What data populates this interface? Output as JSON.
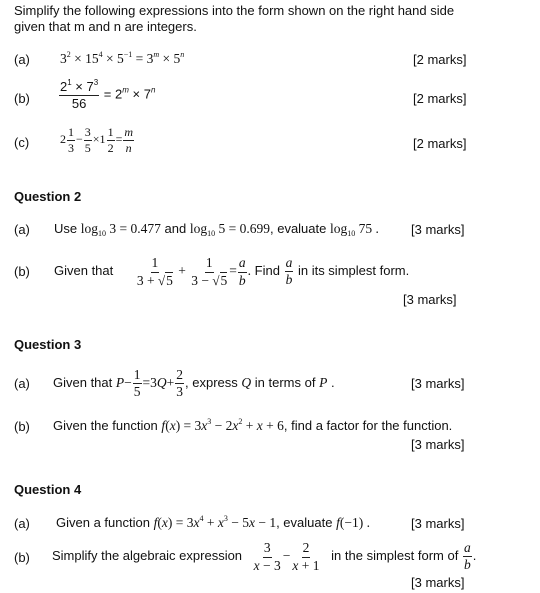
{
  "intro": {
    "line1": "Simplify the following expressions into the form shown on the right hand side",
    "line2": "given that m and n are integers."
  },
  "q1": {
    "a": {
      "label": "(a)",
      "marks": "[2 marks]"
    },
    "b": {
      "label": "(b)",
      "marks": "[2 marks]"
    },
    "c": {
      "label": "(c)",
      "marks": "[2 marks]"
    }
  },
  "q2": {
    "heading": "Question 2",
    "a": {
      "label": "(a)",
      "prefix": "Use",
      "and": "and",
      "mid": ", evaluate",
      "value1": "0.477",
      "value2": "0.699",
      "marks": "[3 marks]"
    },
    "b": {
      "label": "(b)",
      "prefix": "Given that",
      "find": "Find",
      "suffix": "in its simplest form.",
      "marks": "[3 marks]"
    }
  },
  "q3": {
    "heading": "Question 3",
    "a": {
      "label": "(a)",
      "prefix": "Given that",
      "mid": ", express",
      "suffix": "in terms of",
      "marks": "[3 marks]"
    },
    "b": {
      "label": "(b)",
      "prefix": "Given the function",
      "suffix": ", find a factor for the function.",
      "marks": "[3 marks]"
    }
  },
  "q4": {
    "heading": "Question 4",
    "a": {
      "label": "(a)",
      "prefix": "Given a function",
      "mid": ", evaluate",
      "marks": "[3 marks]"
    },
    "b": {
      "label": "(b)",
      "prefix": "Simplify the algebraic expression",
      "suffix": "in the simplest form of",
      "marks": "[3 marks]"
    }
  }
}
